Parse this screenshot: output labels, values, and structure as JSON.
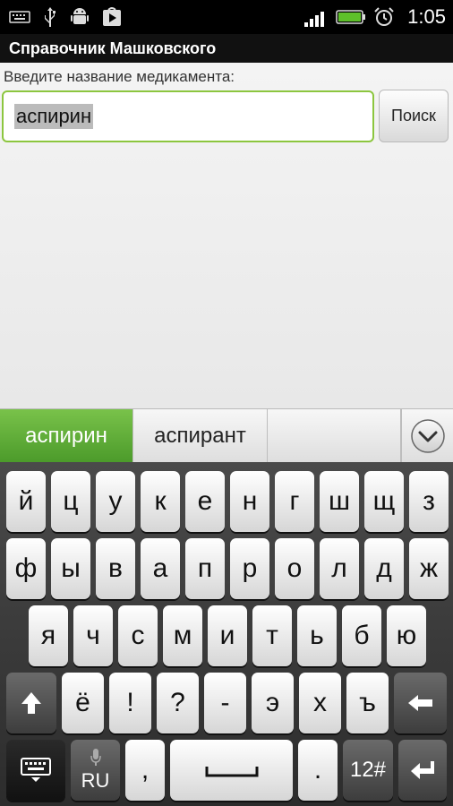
{
  "status_bar": {
    "time": "1:05",
    "icons_left": [
      "keyboard-icon",
      "usb-icon",
      "android-debug-icon",
      "play-store-icon"
    ],
    "icons_right": [
      "signal-icon",
      "battery-icon",
      "alarm-icon"
    ]
  },
  "app": {
    "title": "Справочник Машковского"
  },
  "search": {
    "prompt": "Введите название медикамента:",
    "value": "аспирин",
    "button_label": "Поиск"
  },
  "suggestions": {
    "items": [
      "аспирин",
      "аспирант"
    ],
    "active_index": 0,
    "expand_icon": "chevron-down-icon"
  },
  "keyboard": {
    "row1": [
      "й",
      "ц",
      "у",
      "к",
      "е",
      "н",
      "г",
      "ш",
      "щ",
      "з"
    ],
    "row2": [
      "ф",
      "ы",
      "в",
      "а",
      "п",
      "р",
      "о",
      "л",
      "д",
      "ж"
    ],
    "row3": [
      "я",
      "ч",
      "с",
      "м",
      "и",
      "т",
      "ь",
      "б",
      "ю"
    ],
    "row4": [
      "ё",
      "!",
      "?",
      "-",
      "э",
      "х",
      "ъ"
    ],
    "language_label": "RU",
    "comma_label": ",",
    "period_label": ".",
    "symbols_label": "12#",
    "shift_icon": "shift-icon",
    "backspace_icon": "backspace-icon",
    "enter_icon": "enter-icon",
    "hide_icon": "keyboard-hide-icon",
    "mic_icon": "mic-icon",
    "space_icon": "space-icon"
  },
  "colors": {
    "accent_green": "#8cc63f",
    "suggestion_active": "#5aa832"
  }
}
